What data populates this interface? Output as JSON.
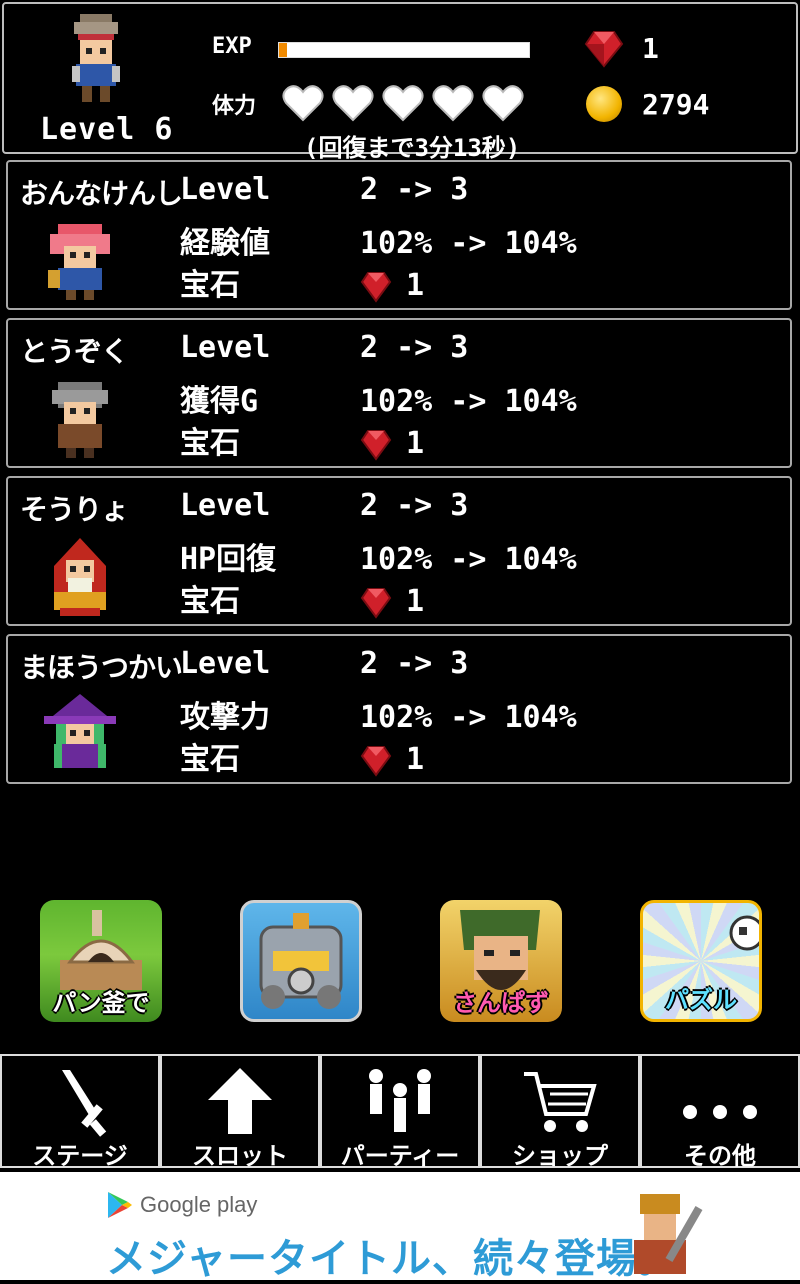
{
  "header": {
    "level_text": "Level 6",
    "exp_label": "EXP",
    "exp_fraction": 0.03,
    "hp_label": "体力",
    "hearts": 5,
    "recover_text": "(回復まで3分13秒)",
    "gems": "1",
    "gold": "2794"
  },
  "party": [
    {
      "name": "おんなけんし",
      "level_label": "Level",
      "level_value": "2 -> 3",
      "stat_label": "経験値",
      "stat_value": "102% -> 104%",
      "gem_label": "宝石",
      "gem_cost": "1",
      "sprite": "female-swordsman"
    },
    {
      "name": "とうぞく",
      "level_label": "Level",
      "level_value": "2 -> 3",
      "stat_label": "獲得G",
      "stat_value": "102% -> 104%",
      "gem_label": "宝石",
      "gem_cost": "1",
      "sprite": "thief"
    },
    {
      "name": "そうりょ",
      "level_label": "Level",
      "level_value": "2 -> 3",
      "stat_label": "HP回復",
      "stat_value": "102% -> 104%",
      "gem_label": "宝石",
      "gem_cost": "1",
      "sprite": "priest"
    },
    {
      "name": "まほうつかい",
      "level_label": "Level",
      "level_value": "2 -> 3",
      "stat_label": "攻撃力",
      "stat_value": "102% -> 104%",
      "gem_label": "宝石",
      "gem_cost": "1",
      "sprite": "wizard"
    }
  ],
  "ads": [
    {
      "label": "パン釜で",
      "icon": "bread-oven-icon"
    },
    {
      "label": "",
      "icon": "robot-icon"
    },
    {
      "label": "さんぱず",
      "icon": "warrior-icon"
    },
    {
      "label": "パズル",
      "icon": "puzzle-icon"
    }
  ],
  "nav": [
    {
      "label": "ステージ",
      "icon": "sword-icon"
    },
    {
      "label": "スロット",
      "icon": "up-arrow-icon"
    },
    {
      "label": "パーティー",
      "icon": "party-icon"
    },
    {
      "label": "ショップ",
      "icon": "cart-icon"
    },
    {
      "label": "その他",
      "icon": "more-icon"
    }
  ],
  "banner": {
    "store_text": "Google play",
    "headline": "メジャータイトル、続々登場。"
  },
  "colors": {
    "exp_fill": "#f08a00",
    "gem": "#d0202a",
    "gold": "#f2b400",
    "banner_text": "#2e9bd6"
  }
}
